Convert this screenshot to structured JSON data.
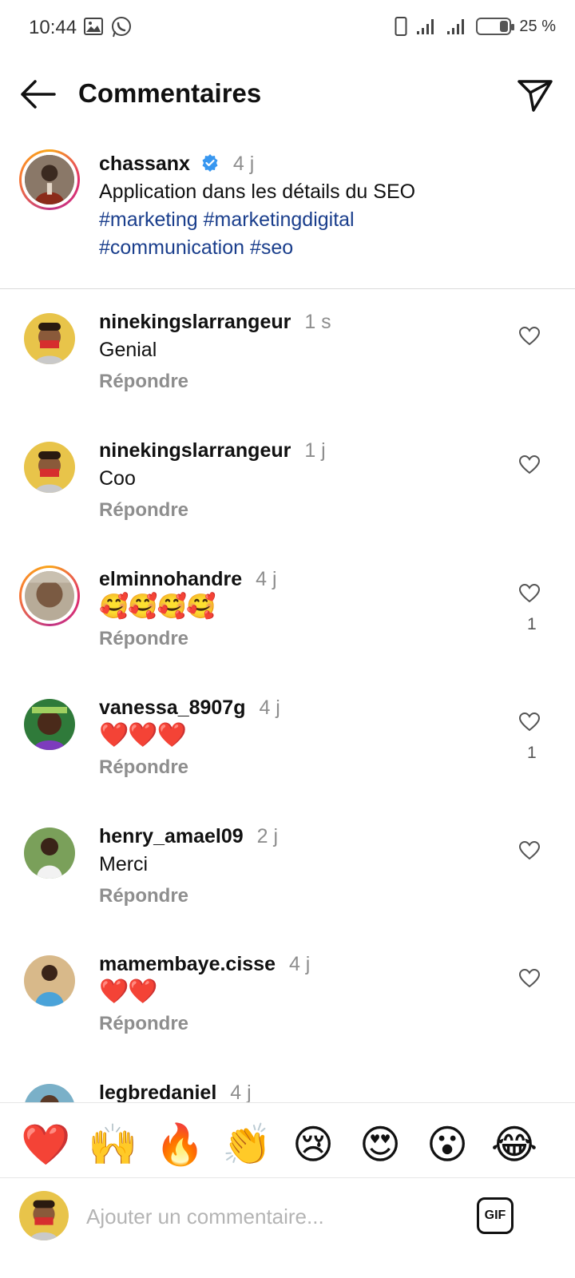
{
  "status_bar": {
    "time": "10:44",
    "battery": "25 %",
    "battery_level": 0.25,
    "icons": [
      "gallery-icon",
      "whatsapp-icon",
      "phone-icon",
      "signal-icon",
      "signal-icon",
      "battery-icon"
    ]
  },
  "header": {
    "title": "Commentaires",
    "back_icon": "back-arrow-icon",
    "share_icon": "send-icon"
  },
  "caption": {
    "username": "chassanx",
    "verified": true,
    "time": "4 j",
    "text": "Application dans les détails du SEO",
    "hashtags_line1": "#marketing #marketingdigital",
    "hashtags_line2": "#communication #seo"
  },
  "comments": [
    {
      "username": "ninekingslarrangeur",
      "time": "1 s",
      "text": "Genial",
      "reply": "Répondre",
      "likes": ""
    },
    {
      "username": "ninekingslarrangeur",
      "time": "1 j",
      "text": "Coo",
      "reply": "Répondre",
      "likes": ""
    },
    {
      "username": "elminnohandre",
      "time": "4 j",
      "text": "🥰🥰🥰🥰",
      "reply": "Répondre",
      "likes": "1"
    },
    {
      "username": "vanessa_8907g",
      "time": "4 j",
      "text": "❤️❤️❤️",
      "reply": "Répondre",
      "likes": "1"
    },
    {
      "username": "henry_amael09",
      "time": "2 j",
      "text": "Merci",
      "reply": "Répondre",
      "likes": ""
    },
    {
      "username": "mamembaye.cisse",
      "time": "4 j",
      "text": "❤️❤️",
      "reply": "Répondre",
      "likes": ""
    },
    {
      "username": "legbredaniel",
      "time": "4 j",
      "text": "",
      "reply": "",
      "likes": ""
    }
  ],
  "emoji_bar": [
    "❤️",
    "🙌",
    "🔥",
    "👏",
    "😢",
    "😍",
    "😮",
    "😂"
  ],
  "input": {
    "placeholder": "Ajouter un commentaire...",
    "gif_label": "GIF"
  },
  "colors": {
    "hashtag": "#1a3e8c",
    "verified": "#3897f0",
    "muted": "#8e8e8e"
  }
}
